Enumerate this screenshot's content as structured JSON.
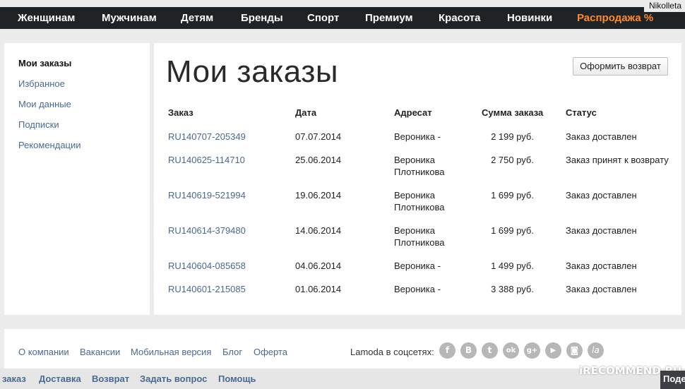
{
  "top_nav": {
    "items": [
      "Женщинам",
      "Мужчинам",
      "Детям",
      "Бренды",
      "Спорт",
      "Премиум",
      "Красота",
      "Новинки",
      "Распродажа %"
    ],
    "sale_color": "#ff8a2c"
  },
  "user_tag": "Nikolleta",
  "sidebar": {
    "items": [
      "Мои заказы",
      "Избранное",
      "Мои данные",
      "Подписки",
      "Рекомендации"
    ],
    "active": "Мои заказы"
  },
  "main": {
    "title": "Мои заказы",
    "return_button": "Оформить возврат",
    "columns": [
      "Заказ",
      "Дата",
      "Адресат",
      "Сумма заказа",
      "Статус"
    ],
    "orders": [
      {
        "number": "RU140707-205349",
        "date": "07.07.2014",
        "recipient": [
          "Вероника -"
        ],
        "sum": "2 199 руб.",
        "status": "Заказ доставлен"
      },
      {
        "number": "RU140625-114710",
        "date": "25.06.2014",
        "recipient": [
          "Вероника",
          "Плотникова"
        ],
        "sum": "2 750 руб.",
        "status": "Заказ принят к возврату"
      },
      {
        "number": "RU140619-521994",
        "date": "19.06.2014",
        "recipient": [
          "Вероника",
          "Плотникова"
        ],
        "sum": "1 699 руб.",
        "status": "Заказ доставлен"
      },
      {
        "number": "RU140614-379480",
        "date": "14.06.2014",
        "recipient": [
          "Вероника",
          "Плотникова"
        ],
        "sum": "1 699 руб.",
        "status": "Заказ доставлен"
      },
      {
        "number": "RU140604-085658",
        "date": "04.06.2014",
        "recipient": [
          "Вероника -"
        ],
        "sum": "1 499 руб.",
        "status": "Заказ доставлен"
      },
      {
        "number": "RU140601-215085",
        "date": "01.06.2014",
        "recipient": [
          "Вероника -"
        ],
        "sum": "3 388 руб.",
        "status": "Заказ доставлен"
      }
    ]
  },
  "footer": {
    "links": [
      "О компании",
      "Вакансии",
      "Мобильная версия",
      "Блог",
      "Оферта"
    ],
    "social_label": "Lamoda в соцсетях:",
    "social": [
      {
        "icon": "facebook-icon",
        "glyph": "f"
      },
      {
        "icon": "vk-icon",
        "glyph": "B"
      },
      {
        "icon": "twitter-icon",
        "glyph": "t"
      },
      {
        "icon": "odnoklassniki-icon",
        "glyph": "ok"
      },
      {
        "icon": "google-plus-icon",
        "glyph": "g+"
      },
      {
        "icon": "youtube-icon",
        "glyph": "▶"
      },
      {
        "icon": "instagram-icon",
        "glyph": "◙"
      },
      {
        "icon": "lamoda-icon",
        "glyph": "la"
      }
    ]
  },
  "bottom_bar": {
    "links": [
      "заказ",
      "Доставка",
      "Возврат",
      "Задать вопрос",
      "Помощь"
    ],
    "right_button": "Поде"
  },
  "watermark": "iRECOMMEND.RU",
  "accent_link_color": "#4a6a93"
}
